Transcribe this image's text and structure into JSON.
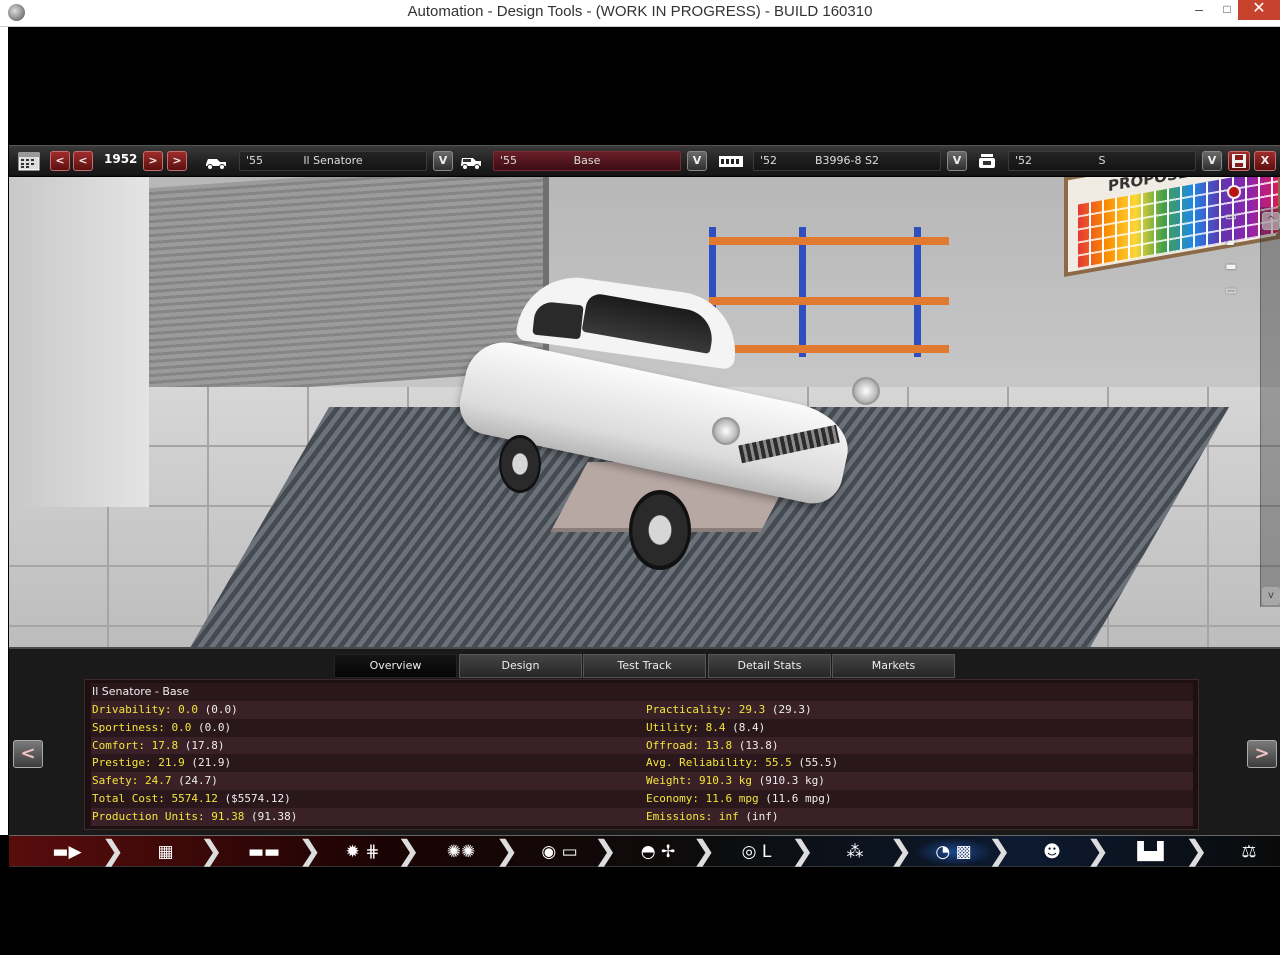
{
  "window": {
    "title": "Automation - Design Tools - (WORK IN PROGRESS) - BUILD 160310",
    "minimize_glyph": "–",
    "maximize_glyph": "□",
    "close_glyph": "✕"
  },
  "toolbar": {
    "calendar_icon": "calendar-icon",
    "prev_label": "<",
    "next_label": ">",
    "year": "1952",
    "model": {
      "icon": "car-model-icon",
      "year": "'55",
      "name": "Il Senatore",
      "dropdown": "V"
    },
    "trim": {
      "icon": "car-trim-icon",
      "year": "'55",
      "name": "Base",
      "dropdown": "V"
    },
    "engine": {
      "icon": "engine-icon",
      "year": "'52",
      "name": "B3996-8 S2",
      "dropdown": "V"
    },
    "engine_variant": {
      "icon": "engine-variant-icon",
      "year": "'52",
      "name": "S",
      "dropdown": "V"
    },
    "save_icon": "save-icon",
    "close_label": "X"
  },
  "scene": {
    "board_text": "PROPOSED COLO",
    "scroll_up": "^",
    "scroll_down": "v",
    "camera_icons": [
      "camera-side-icon",
      "camera-front-icon",
      "camera-three-quarter-icon",
      "camera-rear-icon",
      "camera-top-icon"
    ]
  },
  "tabs": [
    {
      "label": "Overview",
      "active": true
    },
    {
      "label": "Design",
      "active": false
    },
    {
      "label": "Test Track",
      "active": false
    },
    {
      "label": "Detail Stats",
      "active": false
    },
    {
      "label": "Markets",
      "active": false
    }
  ],
  "panel": {
    "prev_label": "<",
    "next_label": ">",
    "header": "Il Senatore - Base",
    "left_stats": [
      {
        "label": "Drivability: 0.0",
        "extra": "(0.0)"
      },
      {
        "label": "Sportiness: 0.0",
        "extra": "(0.0)"
      },
      {
        "label": "Comfort: 17.8",
        "extra": "(17.8)"
      },
      {
        "label": "Prestige: 21.9",
        "extra": "(21.9)"
      },
      {
        "label": "Safety: 24.7",
        "extra": "(24.7)"
      },
      {
        "label": "Total Cost: 5574.12",
        "extra": "($5574.12)"
      },
      {
        "label": "Production Units: 91.38",
        "extra": "(91.38)"
      }
    ],
    "right_stats": [
      {
        "label": "Practicality: 29.3",
        "extra": "(29.3)"
      },
      {
        "label": "Utility: 8.4",
        "extra": "(8.4)"
      },
      {
        "label": "Offroad: 13.8",
        "extra": "(13.8)"
      },
      {
        "label": "Avg. Reliability: 55.5",
        "extra": "(55.5)"
      },
      {
        "label": "Weight: 910.3 kg",
        "extra": "(910.3 kg)"
      },
      {
        "label": "Economy: 11.6 mpg",
        "extra": "(11.6 mpg)"
      },
      {
        "label": "Emissions: inf",
        "extra": "(inf)"
      }
    ]
  },
  "nav": {
    "chevron": "❯",
    "items": [
      {
        "icon": "car-model-icon",
        "glyph": "▬▶"
      },
      {
        "icon": "engine-block-icon",
        "glyph": "▦"
      },
      {
        "icon": "car-trim-icon",
        "glyph": "▬▬"
      },
      {
        "icon": "engine-gearbox-icon",
        "glyph": "✹ ⋕"
      },
      {
        "icon": "suspension-icon",
        "glyph": "✺✺"
      },
      {
        "icon": "wheels-body-icon",
        "glyph": "◉ ▭"
      },
      {
        "icon": "body-fan-icon",
        "glyph": "◓ ✢"
      },
      {
        "icon": "steering-seat-icon",
        "glyph": "◎ L"
      },
      {
        "icon": "tuning-icon",
        "glyph": "⁂"
      },
      {
        "icon": "test-track-icon",
        "glyph": "◔ ▩"
      },
      {
        "icon": "review-icon",
        "glyph": "☻"
      },
      {
        "icon": "factory-icon",
        "glyph": "▙▟"
      },
      {
        "icon": "balance-icon",
        "glyph": "⚖"
      }
    ],
    "active_index": 9
  },
  "colors": {
    "stat_label": "#f2e63a",
    "stat_row_a": "#3a2127",
    "stat_row_b": "#2a171b",
    "close_red": "#c7432e"
  }
}
